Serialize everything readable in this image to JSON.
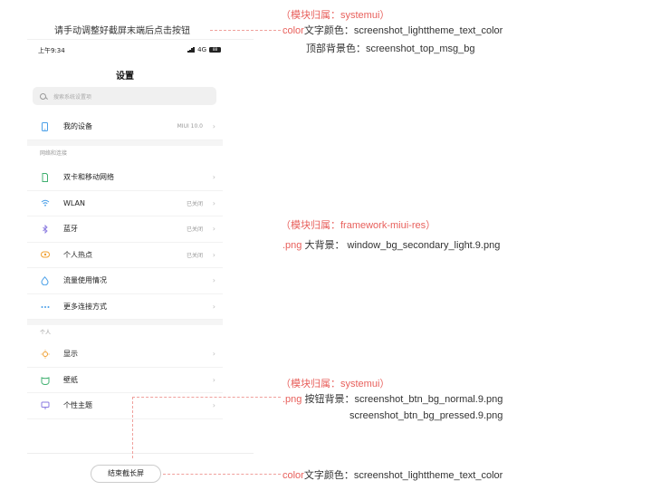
{
  "top_msg": {
    "text": "请手动调整好截屏末端后点击按钮"
  },
  "status_bar": {
    "time": "上午9:34",
    "network": "4G",
    "battery": "88"
  },
  "page_title": "设置",
  "search": {
    "placeholder": "搜索系统设置项"
  },
  "device_row": {
    "label": "我的设备",
    "value": "MIUI 10.0"
  },
  "section_network": {
    "header": "网络和连接"
  },
  "network_items": [
    {
      "icon": "sim-card-icon",
      "label": "双卡和移动网络",
      "value": ""
    },
    {
      "icon": "wifi-icon",
      "label": "WLAN",
      "value": "已关闭"
    },
    {
      "icon": "bluetooth-icon",
      "label": "蓝牙",
      "value": "已关闭"
    },
    {
      "icon": "hotspot-icon",
      "label": "个人热点",
      "value": "已关闭"
    },
    {
      "icon": "data-usage-icon",
      "label": "流量使用情况",
      "value": ""
    },
    {
      "icon": "more-connections-icon",
      "label": "更多连接方式",
      "value": ""
    }
  ],
  "section_personal": {
    "header": "个人"
  },
  "personal_items": [
    {
      "icon": "display-icon",
      "label": "显示"
    },
    {
      "icon": "wallpaper-icon",
      "label": "壁纸"
    },
    {
      "icon": "theme-icon",
      "label": "个性主题"
    }
  ],
  "end_button": {
    "label": "结束截长屏"
  },
  "annotations": {
    "a1_module": "（模块归属：systemui）",
    "a1_prefix": "color",
    "a1_text": "文字颜色：screenshot_lighttheme_text_color",
    "a1_bg": "顶部背景色：screenshot_top_msg_bg",
    "a2_module": "（模块归属：framework-miui-res）",
    "a2_prefix": ".png",
    "a2_text": " 大背景：   window_bg_secondary_light.9.png",
    "a3_module": "（模块归属：systemui）",
    "a3_prefix": ".png",
    "a3_text": " 按钮背景：screenshot_btn_bg_normal.9.png",
    "a3_text2": "screenshot_btn_bg_pressed.9.png",
    "a4_prefix": "color",
    "a4_text": "文字颜色：screenshot_lighttheme_text_color"
  },
  "colors": {
    "annotation_red": "#e8605c",
    "icon_blue": "#4a9fe8",
    "icon_orange": "#f0a030",
    "icon_green": "#40b070",
    "icon_purple": "#8a7ae0"
  }
}
